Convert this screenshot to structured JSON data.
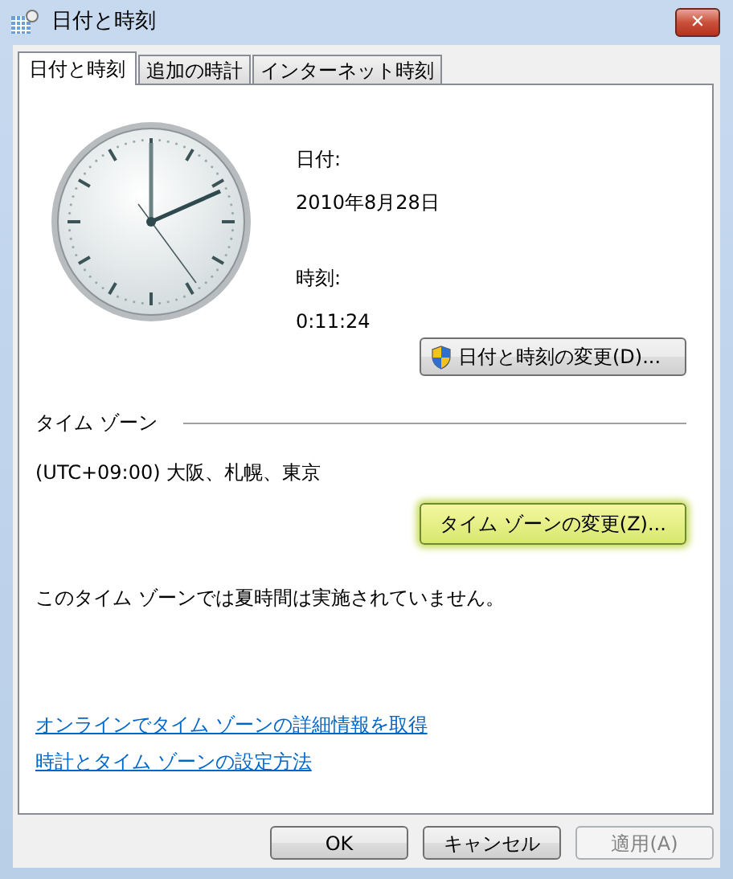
{
  "window": {
    "title": "日付と時刻",
    "close": "✕"
  },
  "tabs": [
    {
      "label": "日付と時刻",
      "selected": true
    },
    {
      "label": "追加の時計",
      "selected": false
    },
    {
      "label": "インターネット時刻",
      "selected": false
    }
  ],
  "date": {
    "label": "日付:",
    "value": "2010年8月28日"
  },
  "time": {
    "label": "時刻:",
    "value": "0:11:24"
  },
  "change_datetime_button": {
    "label": "日付と時刻の変更(D)...",
    "highlighted": false
  },
  "timezone": {
    "heading": "タイム ゾーン",
    "value": "(UTC+09:00) 大阪、札幌、東京",
    "dst_note": "このタイム ゾーンでは夏時間は実施されていません。"
  },
  "change_timezone_button": {
    "label": "タイム ゾーンの変更(Z)...",
    "highlighted": true
  },
  "links": [
    "オンラインでタイム ゾーンの詳細情報を取得",
    "時計とタイム ゾーンの設定方法"
  ],
  "buttons": [
    {
      "label": "OK",
      "disabled": false
    },
    {
      "label": "キャンセル",
      "disabled": false
    },
    {
      "label": "適用(A)",
      "disabled": true
    }
  ]
}
